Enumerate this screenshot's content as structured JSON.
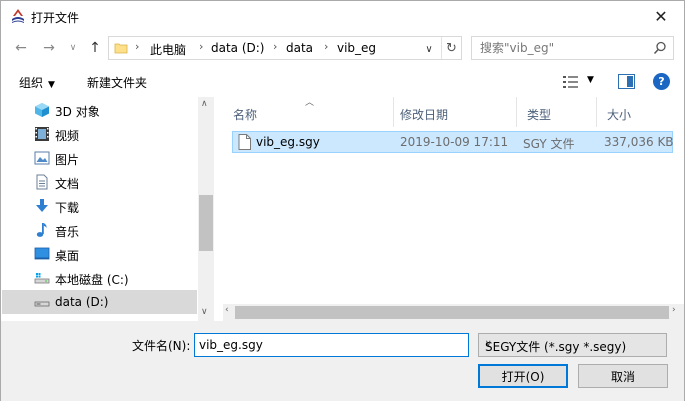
{
  "window": {
    "title": "打开文件"
  },
  "nav": {
    "breadcrumbs": [
      "此电脑",
      "data (D:)",
      "data",
      "vib_eg"
    ],
    "search_placeholder": "搜索\"vib_eg\""
  },
  "toolbar": {
    "organize_label": "组织",
    "new_folder_label": "新建文件夹"
  },
  "sidebar": {
    "items": [
      {
        "label": "3D 对象",
        "icon": "3d-objects-icon"
      },
      {
        "label": "视频",
        "icon": "video-icon"
      },
      {
        "label": "图片",
        "icon": "pictures-icon"
      },
      {
        "label": "文档",
        "icon": "documents-icon"
      },
      {
        "label": "下载",
        "icon": "download-icon"
      },
      {
        "label": "音乐",
        "icon": "music-icon"
      },
      {
        "label": "桌面",
        "icon": "desktop-icon"
      },
      {
        "label": "本地磁盘 (C:)",
        "icon": "drive-icon"
      },
      {
        "label": "data (D:)",
        "icon": "drive-icon"
      }
    ]
  },
  "filelist": {
    "columns": [
      "名称",
      "修改日期",
      "类型",
      "大小"
    ],
    "rows": [
      {
        "name": "vib_eg.sgy",
        "modified": "2019-10-09 17:11",
        "type": "SGY 文件",
        "size": "337,036 KB"
      }
    ]
  },
  "footer": {
    "filename_label": "文件名(N):",
    "filename_value": "vib_eg.sgy",
    "filetype_value": "SEGY文件 (*.sgy *.segy)",
    "open_label": "打开(O)",
    "cancel_label": "取消"
  },
  "colors": {
    "accent": "#0078d7",
    "selection": "#cce8ff",
    "nav_selected": "#d9d9d9"
  }
}
